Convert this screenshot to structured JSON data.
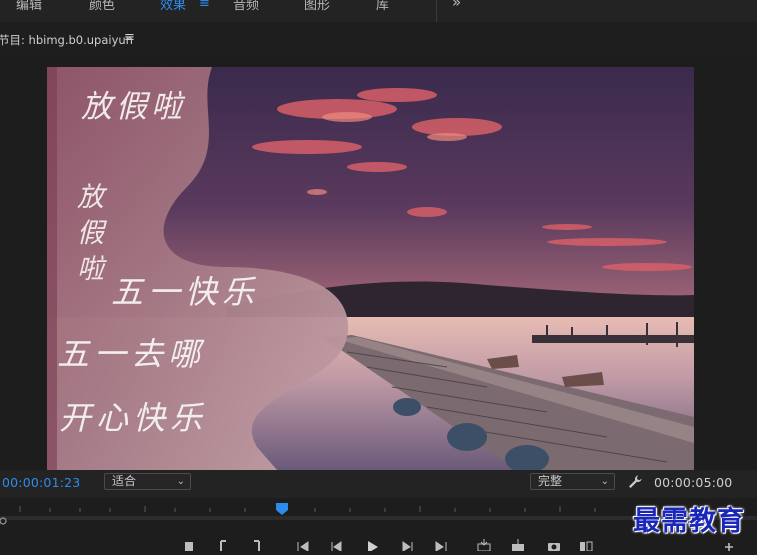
{
  "tabs": [
    {
      "label": "编辑",
      "active": false
    },
    {
      "label": "颜色",
      "active": false
    },
    {
      "label": "效果",
      "active": true
    },
    {
      "label": "音频",
      "active": false
    },
    {
      "label": "图形",
      "active": false
    },
    {
      "label": "库",
      "active": false
    }
  ],
  "tab_menu_glyph": "≡",
  "overflow_glyph": "»",
  "panel": {
    "title": "节目: hbimg.b0.upaiyun",
    "menu_glyph": "≡"
  },
  "frame": {
    "text_lines": [
      "放假啦",
      "放",
      "假",
      "啦",
      "五一快乐",
      "五一去哪",
      "开心快乐"
    ]
  },
  "controls": {
    "timecode_current": "00:00:01:23",
    "zoom_select": "适合",
    "quality_select": "完整",
    "timecode_duration": "00:00:05:00",
    "settings_icon": "wrench-icon"
  },
  "colors": {
    "accent": "#2d8ceb",
    "timecode": "#2d8ceb",
    "playhead": "#2d8ceb",
    "watermark": "#1a27b8"
  },
  "watermark": "最需教育",
  "transport": {
    "buttons": [
      "add-marker-icon",
      "mark-in-icon",
      "mark-out-icon",
      "go-to-in-icon",
      "step-back-icon",
      "play-icon",
      "step-forward-icon",
      "go-to-out-icon",
      "insert-icon",
      "overwrite-icon",
      "export-frame-icon",
      "comparison-view-icon",
      "add-button-icon"
    ]
  }
}
